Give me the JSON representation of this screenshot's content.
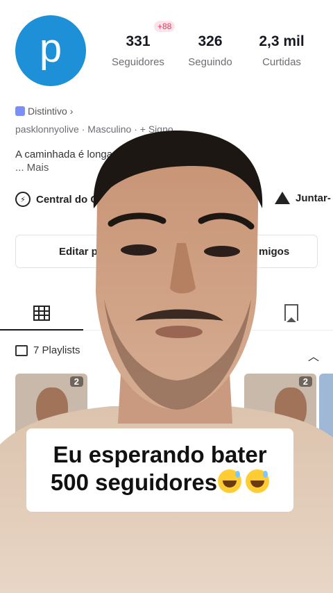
{
  "profile": {
    "avatar_letter": "p",
    "new_followers_badge": "+88",
    "stats": [
      {
        "value": "331",
        "label": "Seguidores"
      },
      {
        "value": "326",
        "label": "Seguindo"
      },
      {
        "value": "2,3 mil",
        "label": "Curtidas"
      }
    ],
    "distintivo": "Distintivo",
    "username": "pasklonnyolive",
    "gender": "Masculino",
    "sign": "+ Signo",
    "bio": "A caminhada é longa",
    "bio_emoji": "❤️🙏",
    "more": "... Mais",
    "central_label": "Central do C",
    "juntar_label": "Juntar-",
    "edit_left": "Editar p",
    "edit_right": "migos",
    "playlists_label": "7 Playlists",
    "thumb_counts": [
      "2",
      "2"
    ]
  },
  "caption": {
    "line1": "Eu esperando bater",
    "line2": "500 seguidores"
  },
  "colors": {
    "avatar_bg": "#1e90d8",
    "accent_red": "#fe2c55",
    "caption_bg": "#ffffff"
  },
  "icons": [
    "location-bolt-icon",
    "tent-icon",
    "grid-icon",
    "bookmark-icon",
    "playlist-icon",
    "chevron-up-icon",
    "badge-hex-icon",
    "sweat-smile-emoji"
  ]
}
